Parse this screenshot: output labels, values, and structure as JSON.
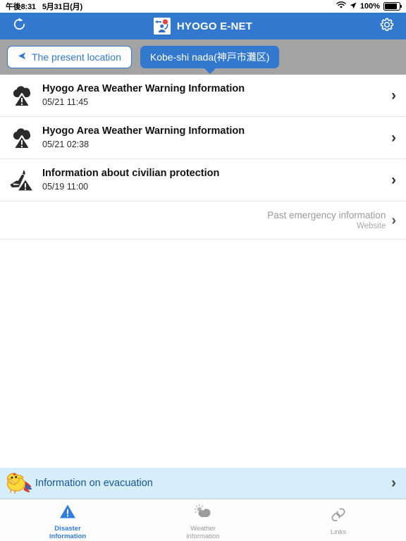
{
  "status_bar": {
    "time": "午後8:31",
    "date": "5月31日(月)",
    "wifi_icon": "wifi-icon",
    "location_icon": "location-arrow-icon",
    "battery_percent": "100%",
    "battery_icon": "battery-full-icon"
  },
  "header": {
    "refresh_icon": "refresh-icon",
    "logo_icon": "hyogo-enet-logo-icon",
    "title": "HYOGO E-NET",
    "settings_icon": "gear-icon",
    "background_color": "#3178ce"
  },
  "location_tabs": {
    "background_color": "#a3a3a3",
    "items": [
      {
        "label": "The present location",
        "icon": "navigation-arrow-icon",
        "selected": false
      },
      {
        "label": "Kobe-shi nada(神戸市灘区)",
        "icon": "",
        "selected": true
      }
    ]
  },
  "alerts": [
    {
      "icon": "cloud-warning-icon",
      "title": "Hyogo Area Weather Warning Information",
      "time": "05/21 11:45",
      "chevron": "chevron-right-icon"
    },
    {
      "icon": "cloud-warning-icon",
      "title": "Hyogo Area Weather Warning Information",
      "time": "05/21 02:38",
      "chevron": "chevron-right-icon"
    },
    {
      "icon": "missile-warning-icon",
      "title": "Information about civilian protection",
      "time": "05/19 11:00",
      "chevron": "chevron-right-icon"
    }
  ],
  "past_link": {
    "title": "Past emergency information",
    "subtitle": "Website",
    "chevron": "chevron-right-icon"
  },
  "evacuation_banner": {
    "icon": "yellow-bird-mascot-icon",
    "label": "Information on evacuation",
    "chevron": "chevron-right-icon",
    "background_color": "#d6eefa",
    "text_color": "#15559e"
  },
  "tab_bar": {
    "active_color": "#2f7de1",
    "inactive_color": "#9a9a9a",
    "tabs": [
      {
        "label": "Disaster\ninformation",
        "icon": "warning-triangle-icon",
        "active": true
      },
      {
        "label": "Weather\ninformation",
        "icon": "sun-cloud-icon",
        "active": false
      },
      {
        "label": "Links",
        "icon": "chain-link-icon",
        "active": false
      }
    ]
  }
}
